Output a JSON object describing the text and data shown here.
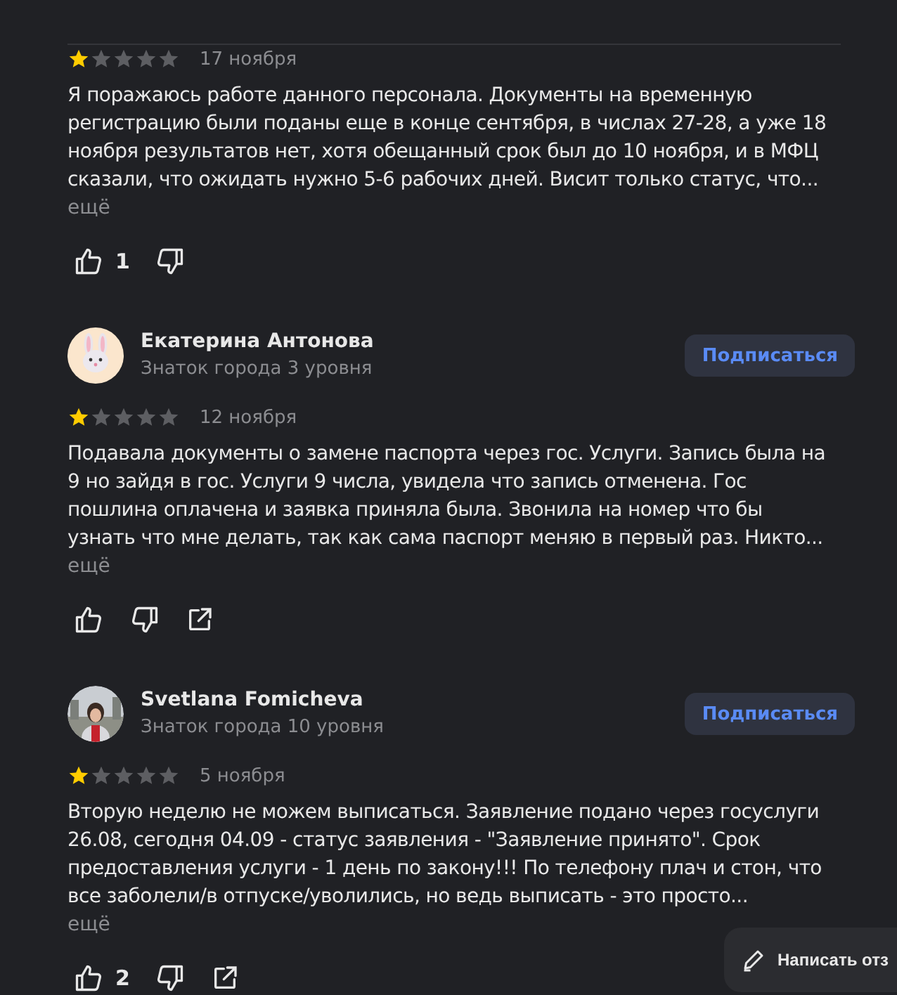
{
  "reviews": [
    {
      "date": "17 ноября",
      "stars": 1,
      "lines": [
        "Я поражаюсь работе данного персонала. Документы на временную",
        "регистрацию были поданы еще в конце сентября, в числах 27-28, а уже 18",
        "ноября результатов нет, хотя обещанный срок был до 10 ноября, и в МФЦ",
        "сказали, что ожидать нужно 5-6 рабочих дней. Висит только статус, что..."
      ],
      "more": "ещё",
      "likes": "1",
      "share": false
    },
    {
      "author": {
        "name": "Екатерина Антонова",
        "level": "Знаток города 3 уровня",
        "avatar": {
          "kind": "bunny"
        },
        "subscribe": "Подписаться"
      },
      "date": "12 ноября",
      "stars": 1,
      "lines": [
        "Подавала документы о замене паспорта через гос. Услуги. Запись была на",
        "9 но зайдя в гос. Услуги 9 числа, увидела что запись отменена. Гос",
        "пошлина оплачена и заявка приняла была. Звонила на номер что бы",
        "узнать что мне делать, так как сама паспорт меняю в первый раз. Никто..."
      ],
      "more": "ещё",
      "share": true
    },
    {
      "author": {
        "name": "Svetlana Fomicheva",
        "level": "Знаток города 10 уровня",
        "subscribe": "Подписаться"
      },
      "date": "5 ноября",
      "stars": 1,
      "lines": [
        "Вторую неделю не можем выписаться. Заявление подано через госуслуги",
        "26.08, сегодня 04.09 - статус заявления - \"Заявление принято\". Срок",
        "предоставления услуги - 1 день по закону!!! По телефону плач и стон, что",
        "все заболели/в отпуске/уволились, но ведь выписать - это просто..."
      ],
      "more": "ещё",
      "likes": "2",
      "share": true
    }
  ],
  "write_button": "Написать отз"
}
